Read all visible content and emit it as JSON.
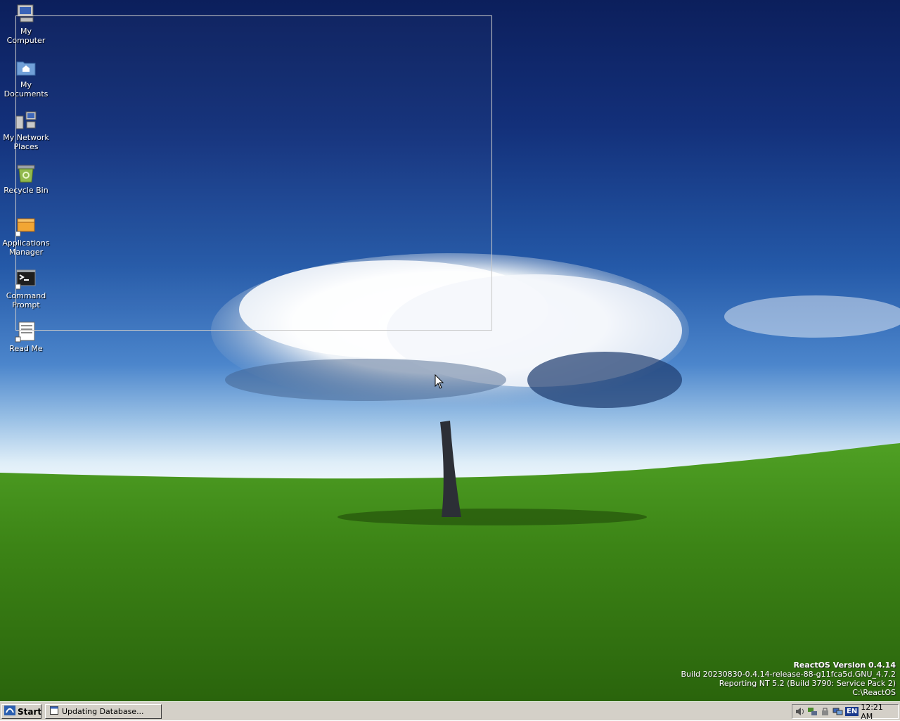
{
  "desktop": {
    "icons": [
      {
        "label": "My Computer",
        "icon": "computer-icon"
      },
      {
        "label": "My Documents",
        "icon": "folder-documents-icon"
      },
      {
        "label": "My Network Places",
        "icon": "network-places-icon"
      },
      {
        "label": "Recycle Bin",
        "icon": "recycle-bin-icon"
      },
      {
        "label": "Applications Manager",
        "icon": "applications-manager-icon"
      },
      {
        "label": "Command Prompt",
        "icon": "command-prompt-icon"
      },
      {
        "label": "Read Me",
        "icon": "read-me-icon"
      }
    ],
    "version": {
      "title": "ReactOS Version 0.4.14",
      "build": "Build 20230830-0.4.14-release-88-g11fca5d.GNU_4.7.2",
      "reporting": "Reporting NT 5.2 (Build 3790: Service Pack 2)",
      "path": "C:\\ReactOS"
    }
  },
  "taskbar": {
    "start_label": "Start",
    "task_label": "Updating Database...",
    "language": "EN",
    "clock": "12:21 AM"
  },
  "colors": {
    "taskbar": "#d4d0c8",
    "sky_top": "#0c1f5c",
    "grass": "#3a7a12"
  }
}
